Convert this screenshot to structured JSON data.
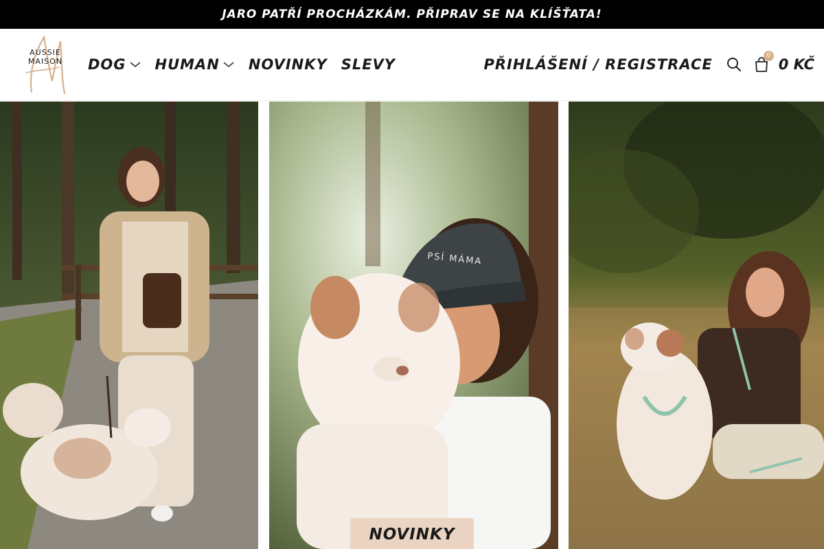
{
  "announcement": "Jaro patří procházkám. Připrav se na klíšťata!",
  "logo": {
    "line1": "AUSSIE",
    "line2": "MAISON",
    "accent_color": "#d8b08c"
  },
  "nav": {
    "items": [
      {
        "label": "DOG",
        "has_dropdown": true
      },
      {
        "label": "HUMAN",
        "has_dropdown": true
      },
      {
        "label": "NOVINKY",
        "has_dropdown": false
      },
      {
        "label": "SLEVY",
        "has_dropdown": false
      }
    ]
  },
  "account": {
    "login_label": "PŘIHLÁŠENÍ / REGISTRACE"
  },
  "cart": {
    "count": "0",
    "total": "0 KČ"
  },
  "icons": {
    "search": "search-icon",
    "cart": "shopping-bag-icon",
    "dropdown": "chevron-down-icon"
  },
  "hero": {
    "cta_label": "NOVINKY",
    "cap_text": "PSÍ MÁMA",
    "cta_color": "#ebd5c2"
  }
}
